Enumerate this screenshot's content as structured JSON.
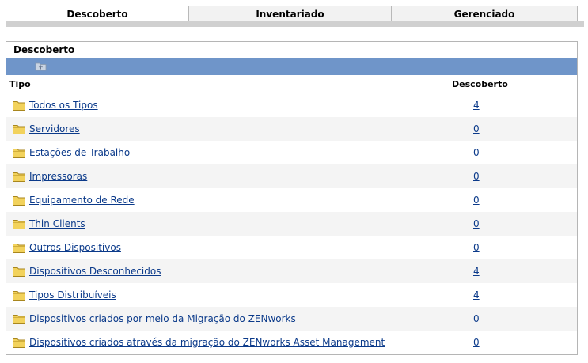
{
  "tabs": [
    {
      "label": "Descoberto",
      "active": true
    },
    {
      "label": "Inventariado",
      "active": false
    },
    {
      "label": "Gerenciado",
      "active": false
    }
  ],
  "panel": {
    "title": "Descoberto",
    "toolbar_icon": "folder-up-icon",
    "columns": {
      "type": "Tipo",
      "count": "Descoberto"
    },
    "rows": [
      {
        "name": "Todos os Tipos",
        "count": "4"
      },
      {
        "name": "Servidores",
        "count": "0"
      },
      {
        "name": "Estações de Trabalho",
        "count": "0"
      },
      {
        "name": "Impressoras",
        "count": "0"
      },
      {
        "name": "Equipamento de Rede",
        "count": "0"
      },
      {
        "name": "Thin Clients",
        "count": "0"
      },
      {
        "name": "Outros Dispositivos",
        "count": "0"
      },
      {
        "name": "Dispositivos Desconhecidos",
        "count": "4"
      },
      {
        "name": "Tipos Distribuíveis",
        "count": "4"
      },
      {
        "name": "Dispositivos criados por meio da Migração do ZENworks",
        "count": "0"
      },
      {
        "name": "Dispositivos criados através da migração do ZENworks Asset Management",
        "count": "0"
      }
    ]
  },
  "colors": {
    "toolbar": "#6f95c9",
    "link": "#0b3a8a",
    "folder": "#e8c54a",
    "row_alt": "#f4f4f4"
  }
}
